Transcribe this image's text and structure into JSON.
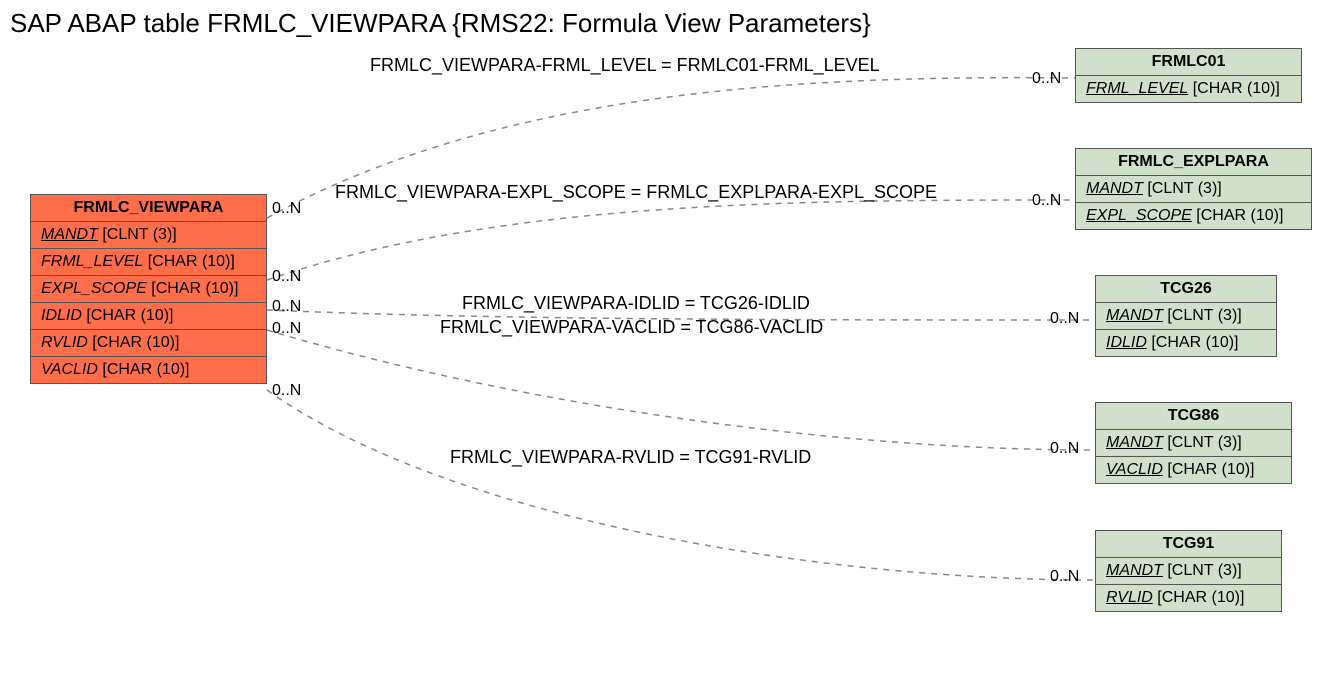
{
  "title": "SAP ABAP table FRMLC_VIEWPARA {RMS22: Formula View Parameters}",
  "main_table": {
    "name": "FRMLC_VIEWPARA",
    "fields": [
      {
        "name": "MANDT",
        "type": "[CLNT (3)]",
        "key": true
      },
      {
        "name": "FRML_LEVEL",
        "type": "[CHAR (10)]",
        "key": false
      },
      {
        "name": "EXPL_SCOPE",
        "type": "[CHAR (10)]",
        "key": false
      },
      {
        "name": "IDLID",
        "type": "[CHAR (10)]",
        "key": false
      },
      {
        "name": "RVLID",
        "type": "[CHAR (10)]",
        "key": false
      },
      {
        "name": "VACLID",
        "type": "[CHAR (10)]",
        "key": false
      }
    ]
  },
  "ref_tables": [
    {
      "name": "FRMLC01",
      "fields": [
        {
          "name": "FRML_LEVEL",
          "type": "[CHAR (10)]",
          "key": true
        }
      ]
    },
    {
      "name": "FRMLC_EXPLPARA",
      "fields": [
        {
          "name": "MANDT",
          "type": "[CLNT (3)]",
          "key": true
        },
        {
          "name": "EXPL_SCOPE",
          "type": "[CHAR (10)]",
          "key": true
        }
      ]
    },
    {
      "name": "TCG26",
      "fields": [
        {
          "name": "MANDT",
          "type": "[CLNT (3)]",
          "key": true
        },
        {
          "name": "IDLID",
          "type": "[CHAR (10)]",
          "key": true
        }
      ]
    },
    {
      "name": "TCG86",
      "fields": [
        {
          "name": "MANDT",
          "type": "[CLNT (3)]",
          "key": true
        },
        {
          "name": "VACLID",
          "type": "[CHAR (10)]",
          "key": true
        }
      ]
    },
    {
      "name": "TCG91",
      "fields": [
        {
          "name": "MANDT",
          "type": "[CLNT (3)]",
          "key": true
        },
        {
          "name": "RVLID",
          "type": "[CHAR (10)]",
          "key": true
        }
      ]
    }
  ],
  "relations": [
    {
      "label": "FRMLC_VIEWPARA-FRML_LEVEL = FRMLC01-FRML_LEVEL",
      "left_mult": "0..N",
      "right_mult": "0..N"
    },
    {
      "label": "FRMLC_VIEWPARA-EXPL_SCOPE = FRMLC_EXPLPARA-EXPL_SCOPE",
      "left_mult": "0..N",
      "right_mult": "0..N"
    },
    {
      "label": "FRMLC_VIEWPARA-IDLID = TCG26-IDLID",
      "left_mult": "0..N",
      "right_mult": "0..N"
    },
    {
      "label": "FRMLC_VIEWPARA-VACLID = TCG86-VACLID",
      "left_mult": "0..N",
      "right_mult": "0..N"
    },
    {
      "label": "FRMLC_VIEWPARA-RVLID = TCG91-RVLID",
      "left_mult": "0..N",
      "right_mult": "0..N"
    }
  ],
  "chart_data": {
    "type": "table",
    "description": "Entity-relationship diagram with one main table and five reference tables linked via foreign-key equality conditions, each with multiplicity 0..N on both ends."
  }
}
